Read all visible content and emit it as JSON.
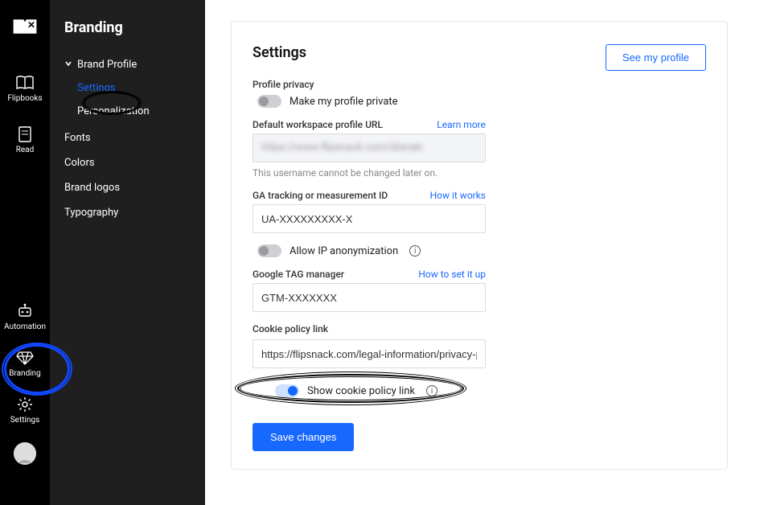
{
  "rail": {
    "items": [
      {
        "label": "Flipbooks"
      },
      {
        "label": "Read"
      }
    ],
    "bottom": [
      {
        "label": "Automation"
      },
      {
        "label": "Branding"
      },
      {
        "label": "Settings"
      }
    ]
  },
  "sidebar": {
    "title": "Branding",
    "group": "Brand Profile",
    "sub": [
      {
        "label": "Settings",
        "active": true
      },
      {
        "label": "Personalization"
      }
    ],
    "items": [
      "Fonts",
      "Colors",
      "Brand logos",
      "Typography"
    ]
  },
  "panel": {
    "title": "Settings",
    "see_profile": "See my profile",
    "privacy_label": "Profile privacy",
    "privacy_toggle": "Make my profile private",
    "url_label": "Default workspace profile URL",
    "learn_more": "Learn more",
    "url_masked": "https://www.flipsnack.com/dianab",
    "url_hint": "This username cannot be changed later on.",
    "ga_label": "GA tracking or measurement ID",
    "how_it_works": "How it works",
    "ga_value": "UA-XXXXXXXXX-X",
    "ip_toggle": "Allow IP anonymization",
    "gtm_label": "Google TAG manager",
    "how_to_setup": "How to set it up",
    "gtm_value": "GTM-XXXXXXX",
    "cookie_label": "Cookie policy link",
    "cookie_value": "https://flipsnack.com/legal-information/privacy-polic",
    "show_cookie": "Show cookie policy link",
    "save": "Save changes"
  }
}
